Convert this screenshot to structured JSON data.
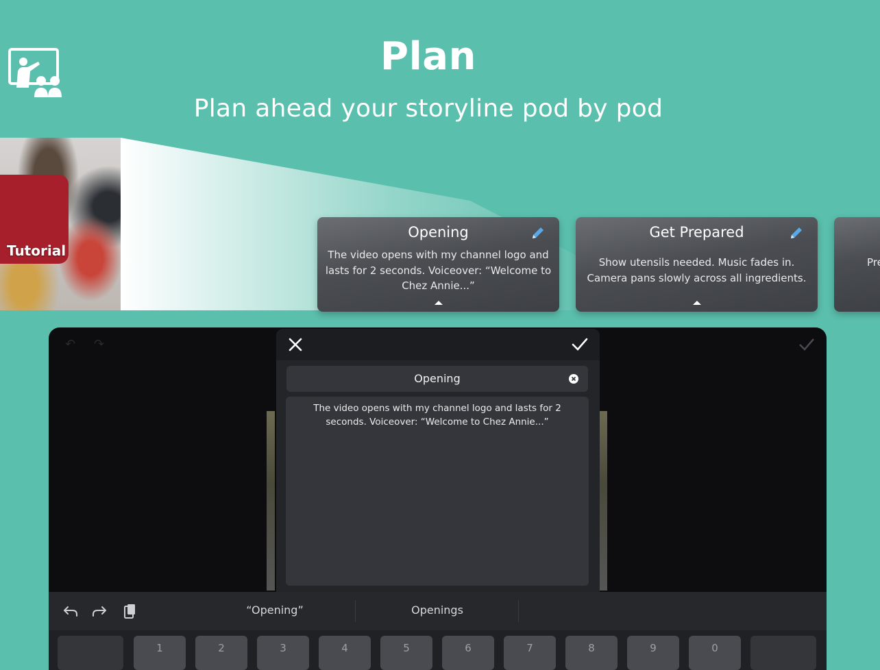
{
  "hero": {
    "title": "Plan",
    "subtitle": "Plan ahead your storyline pod by pod"
  },
  "tutorial": {
    "label": "Tutorial",
    "icon": "presentation-icon",
    "badge_color": "#a61f2b"
  },
  "cards": [
    {
      "title": "Opening",
      "text": "The video opens with my channel logo and lasts for 2 seconds. Voiceover: “Welcome to Chez Annie...”"
    },
    {
      "title": "Get Prepared",
      "text": "Show utensils needed. Music fades in. Camera pans slowly across all ingredients."
    },
    {
      "title": "",
      "text": "Pre"
    }
  ],
  "editor": {
    "title_value": "Opening",
    "description": "The video opens with my channel logo and lasts for 2 seconds. Voiceover: “Welcome to Chez Annie...”"
  },
  "keyboard": {
    "suggestions": [
      "“Opening”",
      "Openings"
    ],
    "keys": [
      "1",
      "2",
      "3",
      "4",
      "5",
      "6",
      "7",
      "8",
      "9",
      "0"
    ]
  },
  "colors": {
    "background": "#5bbfad",
    "accent_pencil": "#5aa9e6"
  }
}
